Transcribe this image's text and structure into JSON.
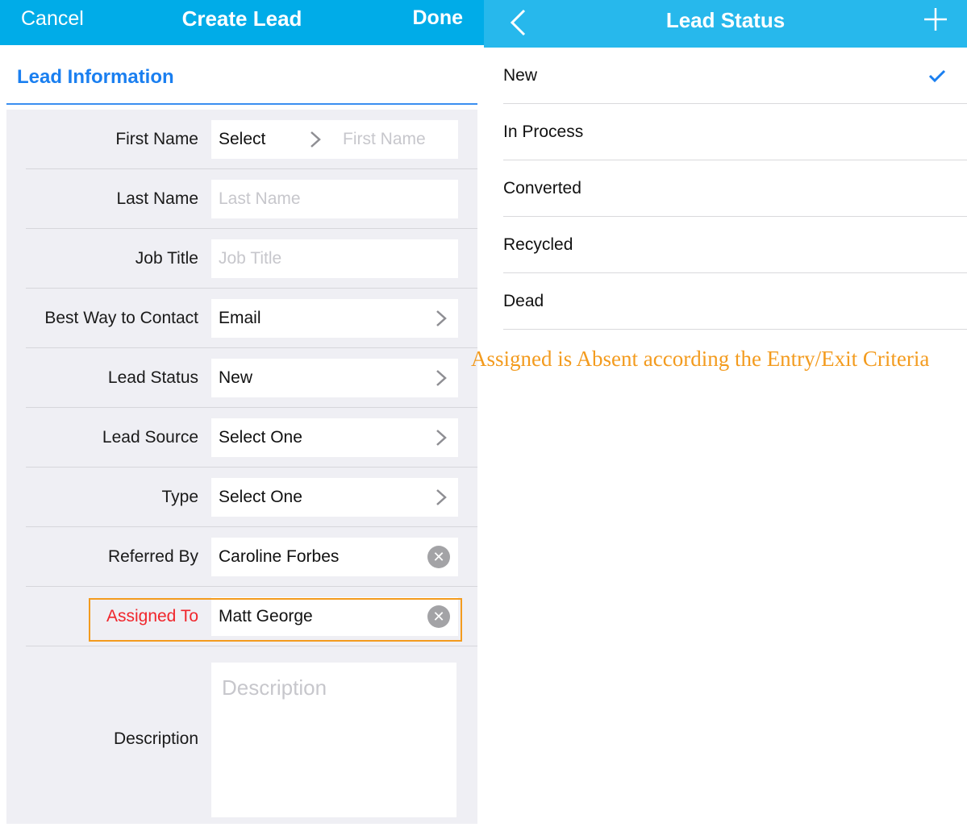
{
  "create_lead": {
    "nav": {
      "cancel_label": "Cancel",
      "title": "Create Lead",
      "done_label": "Done"
    },
    "section_title": "Lead Information",
    "fields": [
      {
        "label": "First Name",
        "value": "Select",
        "placeholder": "First Name",
        "type": "select-plus-input"
      },
      {
        "label": "Last Name",
        "value": "",
        "placeholder": "Last Name",
        "type": "input"
      },
      {
        "label": "Job Title",
        "value": "",
        "placeholder": "Job Title",
        "type": "input"
      },
      {
        "label": "Best Way to Contact",
        "value": "Email",
        "type": "select"
      },
      {
        "label": "Lead Status",
        "value": "New",
        "type": "select"
      },
      {
        "label": "Lead Source",
        "value": "Select One",
        "type": "select"
      },
      {
        "label": "Type",
        "value": "Select One",
        "type": "select"
      },
      {
        "label": "Referred By",
        "value": "Caroline Forbes",
        "type": "lookup"
      },
      {
        "label": "Assigned To",
        "value": "Matt George",
        "type": "lookup",
        "highlighted": true
      }
    ],
    "description": {
      "label": "Description",
      "placeholder": "Description",
      "value": ""
    }
  },
  "lead_status": {
    "nav": {
      "back_icon": "chevron-left-icon",
      "title": "Lead Status",
      "add_icon": "plus-icon"
    },
    "options": [
      {
        "label": "New",
        "selected": true
      },
      {
        "label": "In Process",
        "selected": false
      },
      {
        "label": "Converted",
        "selected": false
      },
      {
        "label": "Recycled",
        "selected": false
      },
      {
        "label": "Dead",
        "selected": false
      }
    ]
  },
  "annotation": "Assigned is Absent according the Entry/Exit Criteria",
  "colors": {
    "nav_left": "#00ace8",
    "nav_right": "#27b8ec",
    "section_accent": "#1a7ff0",
    "highlight_border": "#f39b1e",
    "error_label": "#f0262c",
    "checkmark": "#1a7ff0"
  }
}
